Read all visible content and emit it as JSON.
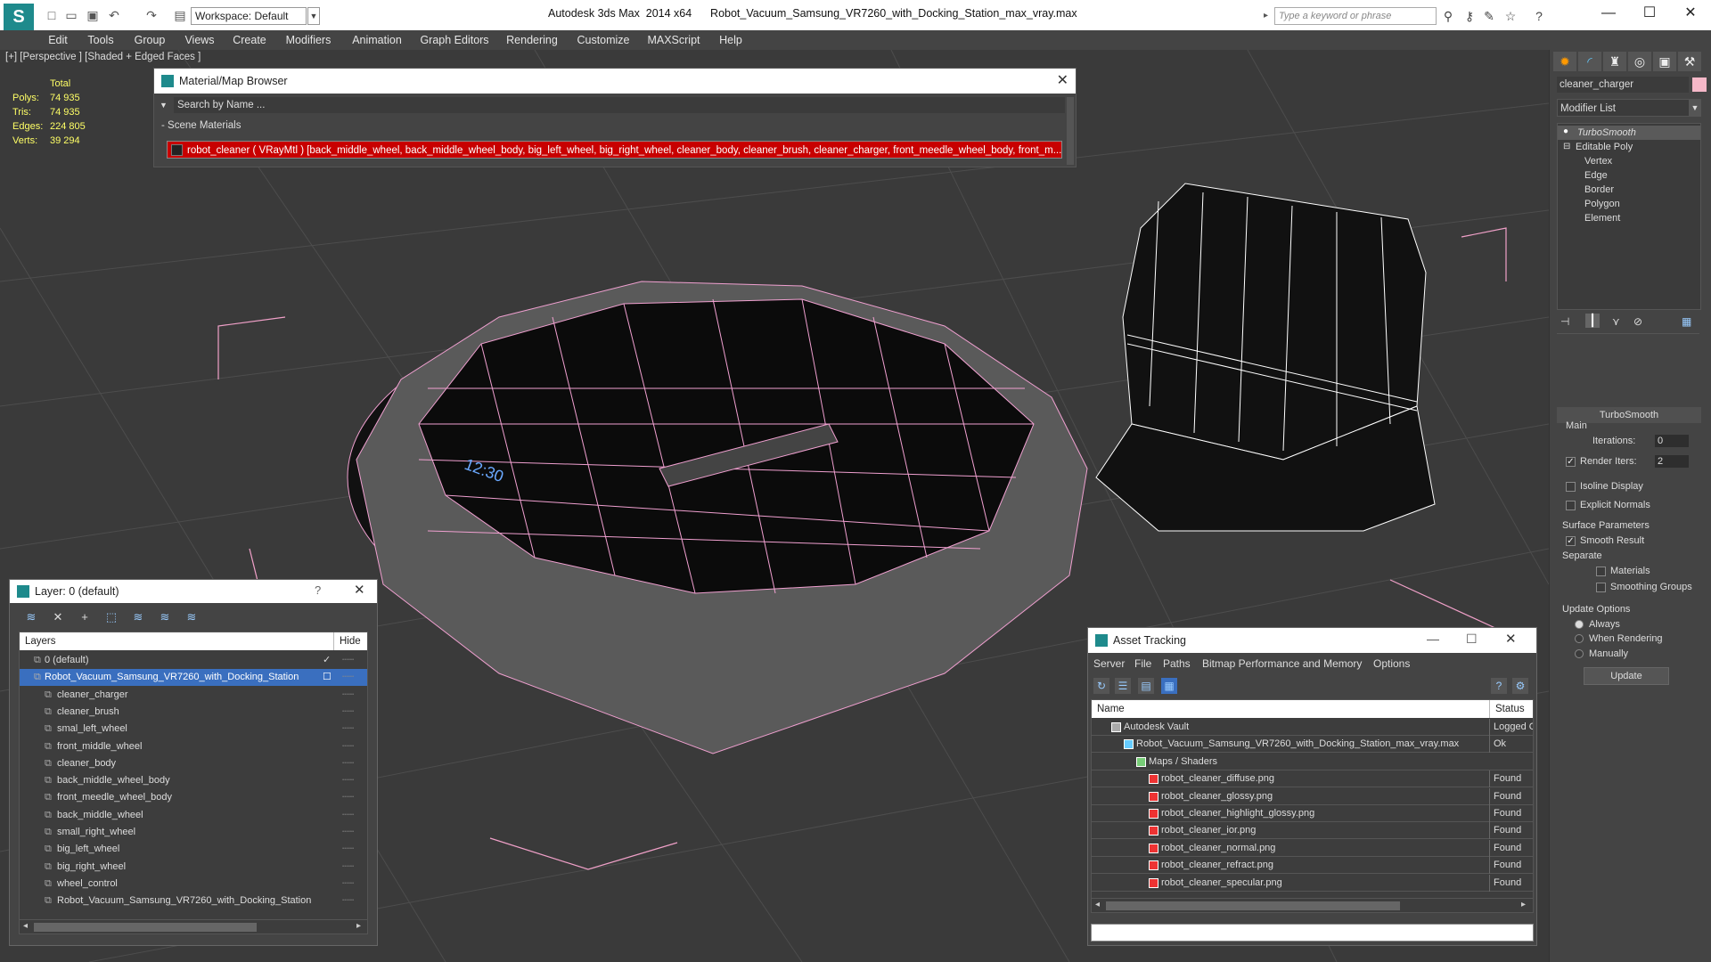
{
  "titlebar": {
    "logo": "S",
    "workspace": "Workspace: Default",
    "title": "Autodesk 3ds Max  2014 x64      Robot_Vacuum_Samsung_VR7260_with_Docking_Station_max_vray.max",
    "search_placeholder": "Type a keyword or phrase"
  },
  "menu": [
    "Edit",
    "Tools",
    "Group",
    "Views",
    "Create",
    "Modifiers",
    "Animation",
    "Graph Editors",
    "Rendering",
    "Customize",
    "MAXScript",
    "Help"
  ],
  "viewport": {
    "label": "[+] [Perspective ] [Shaded + Edged Faces ]",
    "stats_total": "Total",
    "stats": [
      {
        "label": "Polys:",
        "value": "74 935"
      },
      {
        "label": "Tris:",
        "value": "74 935"
      },
      {
        "label": "Edges:",
        "value": "224 805"
      },
      {
        "label": "Verts:",
        "value": "39 294"
      }
    ]
  },
  "material_browser": {
    "title": "Material/Map Browser",
    "search": "Search by Name ...",
    "section": "- Scene Materials",
    "row": "robot_cleaner ( VRayMtl ) [back_middle_wheel, back_middle_wheel_body, big_left_wheel, big_right_wheel, cleaner_body, cleaner_brush, cleaner_charger, front_meedle_wheel_body, front_m..."
  },
  "command_panel": {
    "object_name": "cleaner_charger",
    "modifier_list": "Modifier List",
    "stack": [
      "TurboSmooth",
      "Editable Poly",
      "Vertex",
      "Edge",
      "Border",
      "Polygon",
      "Element"
    ],
    "rollout_title": "TurboSmooth",
    "main_label": "Main",
    "iterations_label": "Iterations:",
    "iterations_value": "0",
    "render_iters_label": "Render Iters:",
    "render_iters_value": "2",
    "isoline": "Isoline Display",
    "explicit": "Explicit Normals",
    "surface_params": "Surface Parameters",
    "smooth_result": "Smooth Result",
    "separate": "Separate",
    "materials": "Materials",
    "smoothing_groups": "Smoothing Groups",
    "update_options": "Update Options",
    "always": "Always",
    "when_rendering": "When Rendering",
    "manually": "Manually",
    "update_button": "Update"
  },
  "layer_dialog": {
    "title": "Layer: 0 (default)",
    "help": "?",
    "col_layers": "Layers",
    "col_hide": "Hide",
    "rows": [
      {
        "label": "0 (default)",
        "indent": 0,
        "selected": false
      },
      {
        "label": "Robot_Vacuum_Samsung_VR7260_with_Docking_Station",
        "indent": 0,
        "selected": true
      },
      {
        "label": "cleaner_charger",
        "indent": 1,
        "selected": false
      },
      {
        "label": "cleaner_brush",
        "indent": 1,
        "selected": false
      },
      {
        "label": "smal_left_wheel",
        "indent": 1,
        "selected": false
      },
      {
        "label": "front_middle_wheel",
        "indent": 1,
        "selected": false
      },
      {
        "label": "cleaner_body",
        "indent": 1,
        "selected": false
      },
      {
        "label": "back_middle_wheel_body",
        "indent": 1,
        "selected": false
      },
      {
        "label": "front_meedle_wheel_body",
        "indent": 1,
        "selected": false
      },
      {
        "label": "back_middle_wheel",
        "indent": 1,
        "selected": false
      },
      {
        "label": "small_right_wheel",
        "indent": 1,
        "selected": false
      },
      {
        "label": "big_left_wheel",
        "indent": 1,
        "selected": false
      },
      {
        "label": "big_right_wheel",
        "indent": 1,
        "selected": false
      },
      {
        "label": "wheel_control",
        "indent": 1,
        "selected": false
      },
      {
        "label": "Robot_Vacuum_Samsung_VR7260_with_Docking_Station",
        "indent": 1,
        "selected": false
      }
    ]
  },
  "asset_tracking": {
    "title": "Asset Tracking",
    "menu": [
      "Server",
      "File",
      "Paths",
      "Bitmap Performance and Memory",
      "Options"
    ],
    "col_name": "Name",
    "col_status": "Status",
    "rows": [
      {
        "name": "Autodesk Vault",
        "status": "Logged O",
        "indent": 1,
        "icon": "vault"
      },
      {
        "name": "Robot_Vacuum_Samsung_VR7260_with_Docking_Station_max_vray.max",
        "status": "Ok",
        "indent": 2,
        "icon": "max"
      },
      {
        "name": "Maps / Shaders",
        "status": "",
        "indent": 3,
        "icon": "folder"
      },
      {
        "name": "robot_cleaner_diffuse.png",
        "status": "Found",
        "indent": 4,
        "icon": "png"
      },
      {
        "name": "robot_cleaner_glossy.png",
        "status": "Found",
        "indent": 4,
        "icon": "png"
      },
      {
        "name": "robot_cleaner_highlight_glossy.png",
        "status": "Found",
        "indent": 4,
        "icon": "png"
      },
      {
        "name": "robot_cleaner_ior.png",
        "status": "Found",
        "indent": 4,
        "icon": "png"
      },
      {
        "name": "robot_cleaner_normal.png",
        "status": "Found",
        "indent": 4,
        "icon": "png"
      },
      {
        "name": "robot_cleaner_refract.png",
        "status": "Found",
        "indent": 4,
        "icon": "png"
      },
      {
        "name": "robot_cleaner_specular.png",
        "status": "Found",
        "indent": 4,
        "icon": "png"
      }
    ]
  }
}
